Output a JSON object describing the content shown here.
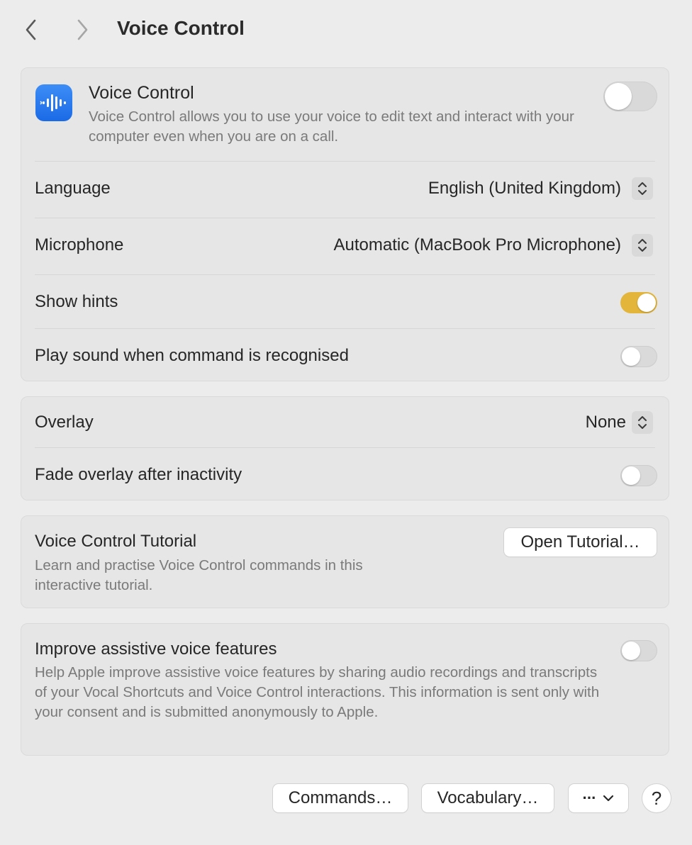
{
  "header": {
    "title": "Voice Control"
  },
  "main_card": {
    "title": "Voice Control",
    "description": "Voice Control allows you to use your voice to edit text and interact with your computer even when you are on a call.",
    "enabled": false,
    "language_label": "Language",
    "language_value": "English (United Kingdom)",
    "microphone_label": "Microphone",
    "microphone_value": "Automatic (MacBook Pro Microphone)",
    "show_hints_label": "Show hints",
    "show_hints_on": true,
    "play_sound_label": "Play sound when command is recognised",
    "play_sound_on": false
  },
  "overlay_card": {
    "overlay_label": "Overlay",
    "overlay_value": "None",
    "fade_label": "Fade overlay after inactivity",
    "fade_on": false
  },
  "tutorial_card": {
    "title": "Voice Control Tutorial",
    "description": "Learn and practise Voice Control commands in this interactive tutorial.",
    "button_label": "Open Tutorial…"
  },
  "improve_card": {
    "title": "Improve assistive voice features",
    "description": "Help Apple improve assistive voice features by sharing audio recordings and transcripts of your Vocal Shortcuts and Voice Control interactions. This information is sent only with your consent and is submitted anonymously to Apple.",
    "enabled": false
  },
  "footer": {
    "commands_label": "Commands…",
    "vocabulary_label": "Vocabulary…",
    "more_label": "···",
    "help_label": "?"
  },
  "colors": {
    "accent_toggle": "#e3b53b",
    "icon_blue": "#1b6ae6"
  }
}
